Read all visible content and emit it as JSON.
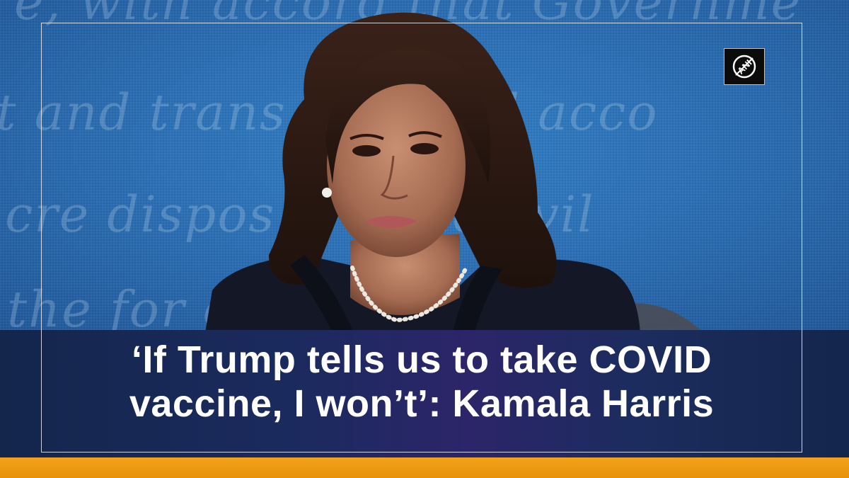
{
  "headline": {
    "line1": "‘If Trump tells us to take COVID",
    "line2": "vaccine, I won’t’: Kamala Harris"
  },
  "logo": {
    "text": "ANI",
    "icon": "ani-logo"
  },
  "colors": {
    "backdrop": "#2a6fb5",
    "caption_band": "#1b2a5e",
    "bottom_stripe": "#f3a21a",
    "caption_text": "#ffffff"
  }
}
